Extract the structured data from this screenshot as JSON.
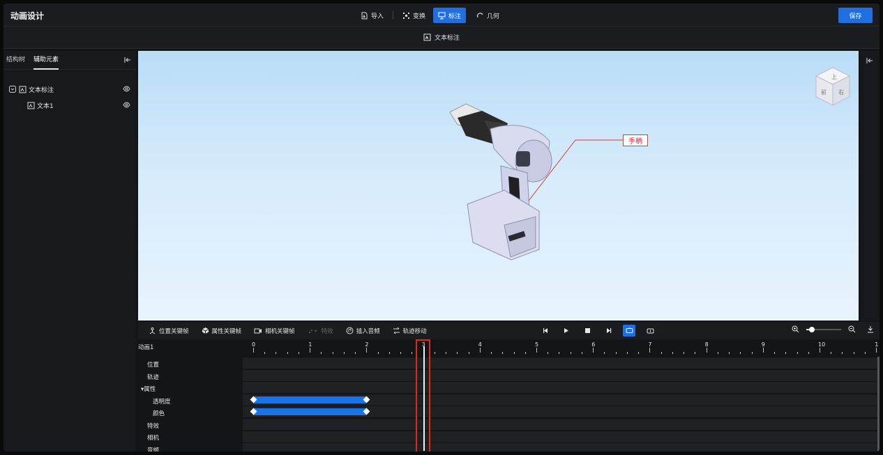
{
  "app": {
    "title": "动画设计"
  },
  "toolbar": {
    "tools": [
      {
        "label": "导入",
        "icon": "import-icon"
      },
      {
        "label": "变换",
        "icon": "transform-icon"
      },
      {
        "label": "标注",
        "icon": "annotation-icon",
        "active": true
      },
      {
        "label": "几何",
        "icon": "geometry-icon"
      }
    ],
    "save_label": "保存"
  },
  "subbar": {
    "label": "文本标注"
  },
  "left_panel": {
    "tabs": [
      "结构树",
      "辅助元素"
    ],
    "active_tab": 1,
    "tree": [
      {
        "label": "文本标注",
        "level": 0,
        "expanded": true
      },
      {
        "label": "文本1",
        "level": 1
      }
    ]
  },
  "viewport": {
    "annotation_text": "手柄",
    "viewcube_labels": [
      "上",
      "前",
      "右"
    ]
  },
  "timeline": {
    "toolbar": [
      {
        "label": "位置关键帧",
        "icon": "position-keyframe-icon",
        "enabled": true
      },
      {
        "label": "属性关键帧",
        "icon": "property-keyframe-icon",
        "enabled": true
      },
      {
        "label": "相机关键帧",
        "icon": "camera-keyframe-icon",
        "enabled": true
      },
      {
        "label": "特效",
        "icon": "effect-icon",
        "enabled": false
      },
      {
        "label": "插入音频",
        "icon": "audio-icon",
        "enabled": true
      },
      {
        "label": "轨迹移动",
        "icon": "track-move-icon",
        "enabled": true
      }
    ],
    "animation_name": "动画1",
    "ruler_numbers": [
      "0",
      "1",
      "2",
      "3",
      "4",
      "5",
      "6",
      "7",
      "8",
      "9",
      "10",
      "1"
    ],
    "playhead_time": 3,
    "tracks": [
      {
        "label": "位置",
        "indent": 1
      },
      {
        "label": "轨迹",
        "indent": 1
      },
      {
        "label": "▾属性",
        "indent": 0
      },
      {
        "label": "透明度",
        "indent": 2,
        "keyframes": [
          0,
          2
        ]
      },
      {
        "label": "颜色",
        "indent": 2,
        "keyframes": [
          0,
          2
        ]
      },
      {
        "label": "特效",
        "indent": 1
      },
      {
        "label": "相机",
        "indent": 1
      },
      {
        "label": "音频",
        "indent": 1
      }
    ]
  },
  "colors": {
    "accent": "#1f6fe0",
    "keyframe_bar": "#1a73e8",
    "playhead_frame": "#e02a1a",
    "annotation_border": "#e03a2a"
  }
}
